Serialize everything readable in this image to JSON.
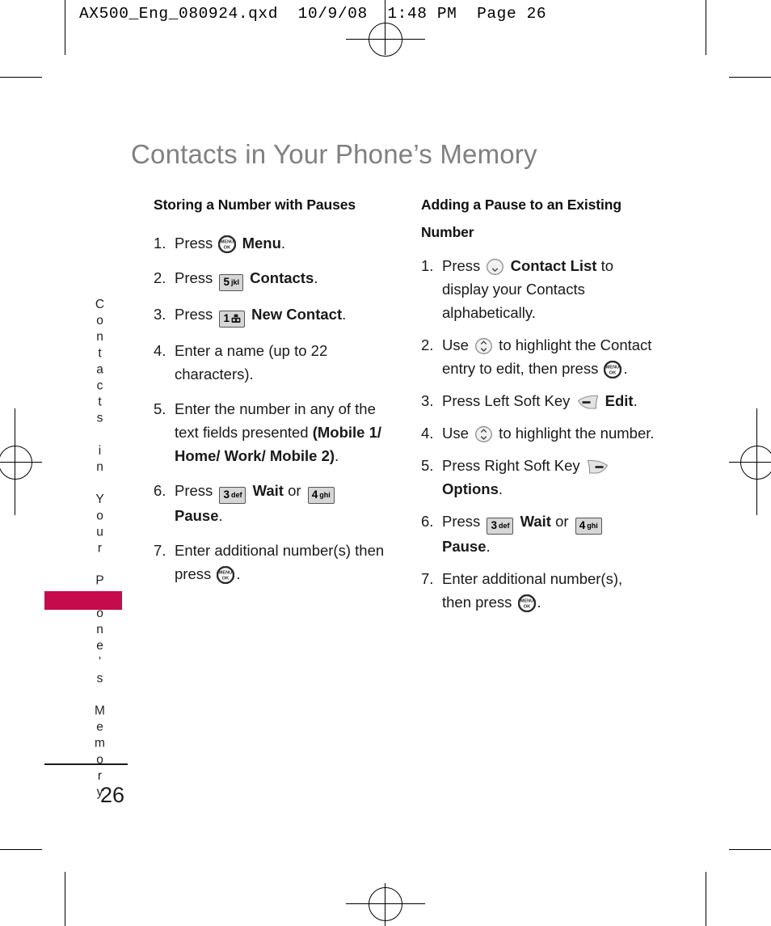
{
  "slug": "AX500_Eng_080924.qxd  10/9/08  1:48 PM  Page 26",
  "page_title": "Contacts in Your Phone’s Memory",
  "side_tab_text": "Contacts in Your Phone’s Memory",
  "side_tab_color": "#C60B4C",
  "folio": "26",
  "left_column": {
    "heading": "Storing a Number with Pauses",
    "steps": [
      {
        "num": "1.",
        "parts": [
          {
            "t": "text",
            "v": "Press "
          },
          {
            "t": "okkey",
            "v": "MENU OK"
          },
          {
            "t": "bold",
            "v": " Menu"
          },
          {
            "t": "text",
            "v": "."
          }
        ]
      },
      {
        "num": "2.",
        "parts": [
          {
            "t": "text",
            "v": "Press "
          },
          {
            "t": "keycap",
            "digit": "5",
            "letters": "jkl"
          },
          {
            "t": "bold",
            "v": " Contacts"
          },
          {
            "t": "text",
            "v": "."
          }
        ]
      },
      {
        "num": "3.",
        "parts": [
          {
            "t": "text",
            "v": "Press "
          },
          {
            "t": "keycap",
            "digit": "1",
            "letters": "voicemail-glyph"
          },
          {
            "t": "bold",
            "v": " New Contact"
          },
          {
            "t": "text",
            "v": "."
          }
        ]
      },
      {
        "num": "4.",
        "parts": [
          {
            "t": "text",
            "v": "Enter a name (up to 22 characters)."
          }
        ]
      },
      {
        "num": "5.",
        "parts": [
          {
            "t": "text",
            "v": "Enter the number in any of the text fields presented "
          },
          {
            "t": "bold",
            "v": "(Mobile 1/ Home/ Work/ Mobile 2)"
          },
          {
            "t": "text",
            "v": "."
          }
        ]
      },
      {
        "num": "6.",
        "parts": [
          {
            "t": "text",
            "v": "Press "
          },
          {
            "t": "keycap",
            "digit": "3",
            "letters": "def"
          },
          {
            "t": "bold",
            "v": " Wait"
          },
          {
            "t": "text",
            "v": " or "
          },
          {
            "t": "keycap",
            "digit": "4",
            "letters": "ghi"
          },
          {
            "t": "bold",
            "v": " Pause"
          },
          {
            "t": "text",
            "v": "."
          }
        ]
      },
      {
        "num": "7.",
        "parts": [
          {
            "t": "text",
            "v": "Enter additional number(s) then press "
          },
          {
            "t": "okkey",
            "v": "MENU OK"
          },
          {
            "t": "text",
            "v": "."
          }
        ]
      }
    ]
  },
  "right_column": {
    "heading": "Adding a Pause to an Existing Number",
    "steps": [
      {
        "num": "1.",
        "parts": [
          {
            "t": "text",
            "v": "Press "
          },
          {
            "t": "navkey",
            "v": "down-arrow"
          },
          {
            "t": "bold",
            "v": " Contact List"
          },
          {
            "t": "text",
            "v": " to display your Contacts alphabetically."
          }
        ]
      },
      {
        "num": "2.",
        "parts": [
          {
            "t": "text",
            "v": "Use "
          },
          {
            "t": "navkey",
            "v": "up-down-arrows"
          },
          {
            "t": "text",
            "v": " to highlight the Contact entry to edit, then press "
          },
          {
            "t": "okkey",
            "v": "MENU OK"
          },
          {
            "t": "text",
            "v": "."
          }
        ]
      },
      {
        "num": "3.",
        "parts": [
          {
            "t": "text",
            "v": "Press Left Soft Key "
          },
          {
            "t": "softkey",
            "v": "left"
          },
          {
            "t": "bold",
            "v": " Edit"
          },
          {
            "t": "text",
            "v": "."
          }
        ]
      },
      {
        "num": "4.",
        "parts": [
          {
            "t": "text",
            "v": "Use "
          },
          {
            "t": "navkey",
            "v": "up-down-arrows"
          },
          {
            "t": "text",
            "v": " to highlight the number."
          }
        ]
      },
      {
        "num": "5.",
        "parts": [
          {
            "t": "text",
            "v": "Press Right Soft Key "
          },
          {
            "t": "softkey",
            "v": "right"
          },
          {
            "t": "bold",
            "v": " Options"
          },
          {
            "t": "text",
            "v": "."
          }
        ]
      },
      {
        "num": "6.",
        "parts": [
          {
            "t": "text",
            "v": "Press "
          },
          {
            "t": "keycap",
            "digit": "3",
            "letters": "def"
          },
          {
            "t": "bold",
            "v": " Wait"
          },
          {
            "t": "text",
            "v": " or "
          },
          {
            "t": "keycap",
            "digit": "4",
            "letters": "ghi"
          },
          {
            "t": "bold",
            "v": " Pause"
          },
          {
            "t": "text",
            "v": "."
          }
        ]
      },
      {
        "num": "7.",
        "parts": [
          {
            "t": "text",
            "v": "Enter additional number(s), then press "
          },
          {
            "t": "okkey",
            "v": "MENU OK"
          },
          {
            "t": "text",
            "v": "."
          }
        ]
      }
    ]
  }
}
